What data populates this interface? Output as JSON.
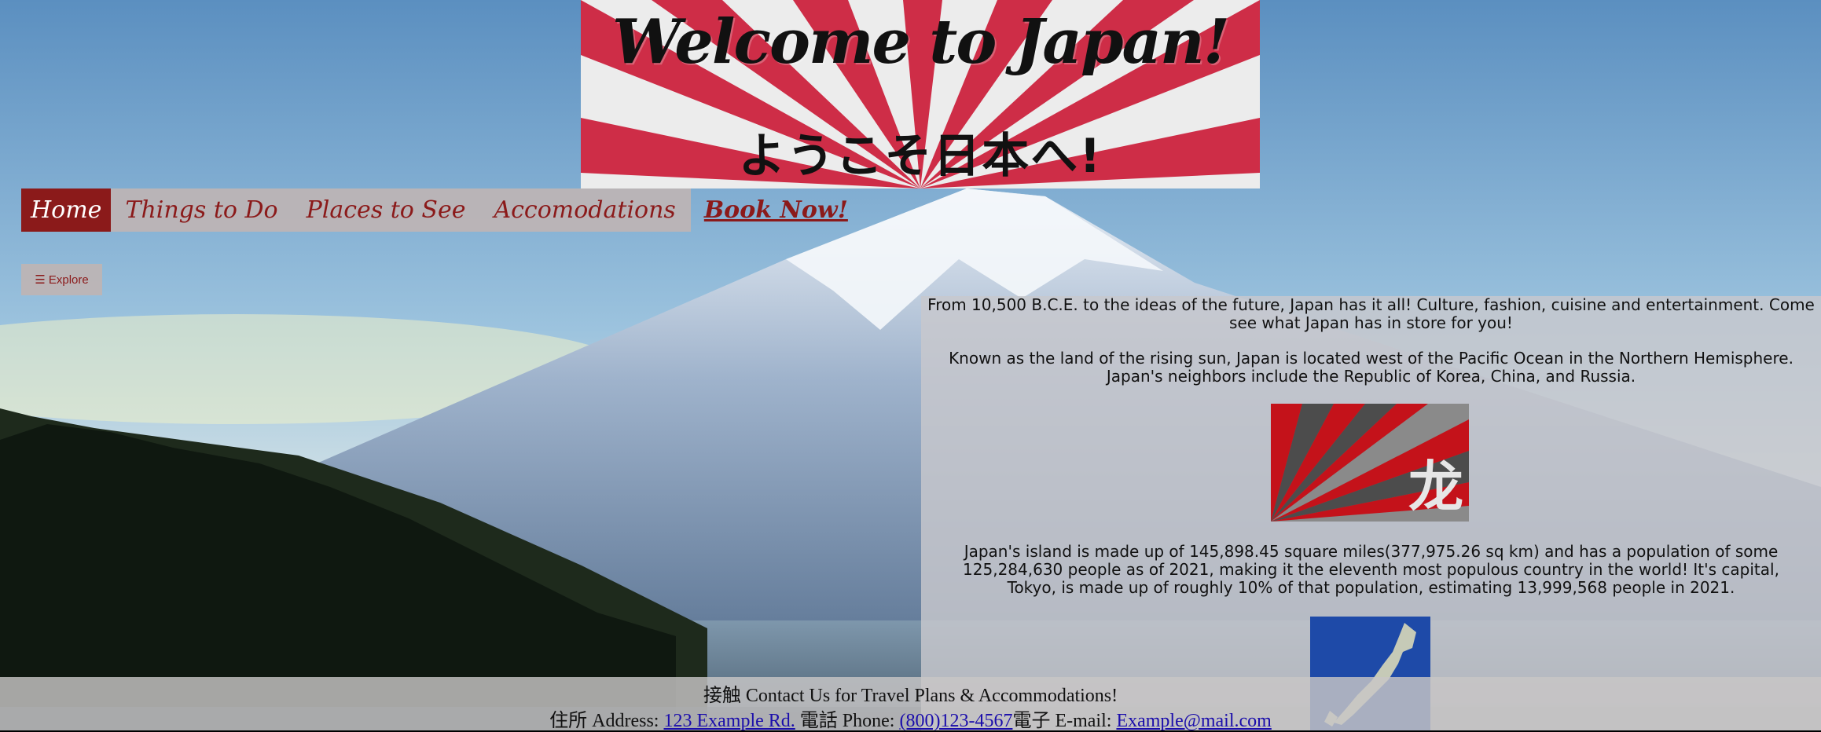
{
  "banner": {
    "title": "Welcome to Japan!",
    "subtitle": "ようこそ日本へ!"
  },
  "nav": {
    "items": [
      {
        "label": "Home",
        "active": true
      },
      {
        "label": "Things to Do"
      },
      {
        "label": "Places to See"
      },
      {
        "label": "Accomodations"
      },
      {
        "label": "Book Now!"
      }
    ]
  },
  "explore": {
    "label": "☰ Explore"
  },
  "content": {
    "paragraph1": "From 10,500 B.C.E. to the ideas of the future, Japan has it all! Culture, fashion, cuisine and entertainment. Come see what Japan has in store for you!",
    "paragraph2": "Known as the land of the rising sun, Japan is located west of the Pacific Ocean in the Northern Hemisphere. Japan's neighbors include the Republic of Korea, China, and Russia.",
    "flag_glyph": "龙",
    "paragraph3": "Japan's island is made up of 145,898.45 square miles(377,975.26 sq km) and has a population of some 125,284,630 people as of 2021, making it the eleventh most populous country in the world! It's capital, Tokyo, is made up of roughly 10% of that population, estimating 13,999,568 people in 2021."
  },
  "footer": {
    "contact": "接触 Contact Us for Travel Plans & Accommodations!",
    "address_label": "住所 Address: ",
    "address": "123 Example Rd.",
    "phone_label": " 電話 Phone: ",
    "phone": "(800)123-4567",
    "email_label": "電子 E-mail: ",
    "email": "Example@mail.com"
  },
  "colors": {
    "accent": "#8b1a1a",
    "banner_red": "#c8102e",
    "link": "#1a0dab"
  }
}
